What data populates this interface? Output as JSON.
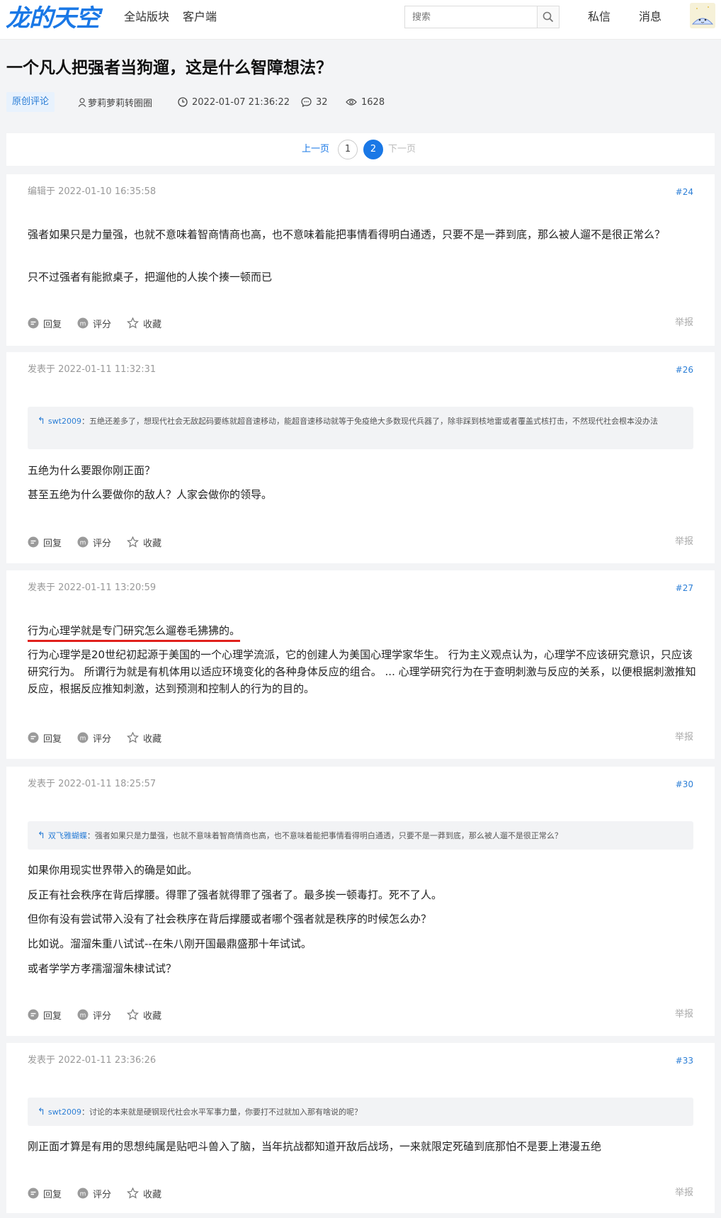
{
  "header": {
    "logo": "龙的天空",
    "nav": [
      "全站版块",
      "客户端"
    ],
    "search_placeholder": "搜索",
    "private_msg": "私信",
    "messages": "消息"
  },
  "thread": {
    "title": "一个凡人把强者当狗遛，这是什么智障想法？",
    "tag": "原创评论",
    "author": "萝莉萝莉转圈圈",
    "time": "2022-01-07 21:36:22",
    "comments": "32",
    "views": "1628"
  },
  "pager": {
    "prev": "上一页",
    "pages": [
      "1",
      "2"
    ],
    "next": "下一页"
  },
  "actions": {
    "reply": "回复",
    "rate": "评分",
    "collect": "收藏",
    "report": "举报"
  },
  "posts": [
    {
      "date": "编辑于 2022-01-10 16:35:58",
      "floor": "#24",
      "paragraphs": [
        "强者如果只是力量强，也就不意味着智商情商也高，也不意味着能把事情看得明白通透，只要不是一莽到底，那么被人遛不是很正常么？",
        "只不过强者有能掀桌子，把遛他的人挨个揍一顿而已"
      ]
    },
    {
      "date": "发表于 2022-01-11 11:32:31",
      "floor": "#26",
      "quote_user": "swt2009",
      "quote_text": "：五绝还差多了，想现代社会无敌起码要练就超音速移动，能超音速移动就等于免疫绝大多数现代兵器了，除非踩到核地雷或者覆盖式核打击，不然现代社会根本没办法",
      "paragraphs": [
        "五绝为什么要跟你刚正面？",
        "甚至五绝为什么要做你的敌人？人家会做你的领导。"
      ]
    },
    {
      "date": "发表于 2022-01-11 13:20:59",
      "floor": "#27",
      "paragraphs": [
        "行为心理学就是专门研究怎么遛卷毛狒狒的。",
        "行为心理学是20世纪初起源于美国的一个心理学流派，它的创建人为美国心理学家华生。 行为主义观点认为，心理学不应该研究意识，只应该研究行为。 所谓行为就是有机体用以适应环境变化的各种身体反应的组合。 ... 心理学研究行为在于查明刺激与反应的关系，以便根据刺激推知反应，根据反应推知刺激，达到预测和控制人的行为的目的。"
      ]
    },
    {
      "date": "发表于 2022-01-11 18:25:57",
      "floor": "#30",
      "quote_user": "双飞雅蝴蝶",
      "quote_text": "：强者如果只是力量强，也就不意味着智商情商也高，也不意味着能把事情看得明白通透，只要不是一莽到底，那么被人遛不是很正常么？",
      "paragraphs": [
        "如果你用现实世界带入的确是如此。",
        "反正有社会秩序在背后撑腰。得罪了强者就得罪了强者了。最多挨一顿毒打。死不了人。",
        "但你有没有尝试带入没有了社会秩序在背后撑腰或者哪个强者就是秩序的时候怎么办？",
        "比如说。溜溜朱重八试试--在朱八刚开国最鼎盛那十年试试。",
        "或者学学方孝孺溜溜朱棣试试？"
      ]
    },
    {
      "date": "发表于 2022-01-11 23:36:26",
      "floor": "#33",
      "quote_user": "swt2009",
      "quote_text": "：讨论的本来就是硬钢现代社会水平军事力量，你要打不过就加入那有啥说的呢？",
      "paragraphs": [
        "刚正面才算是有用的思想纯属是贴吧斗兽入了脑，当年抗战都知道开敌后战场，一来就限定死磕到底那怕不是要上港漫五绝"
      ]
    }
  ]
}
